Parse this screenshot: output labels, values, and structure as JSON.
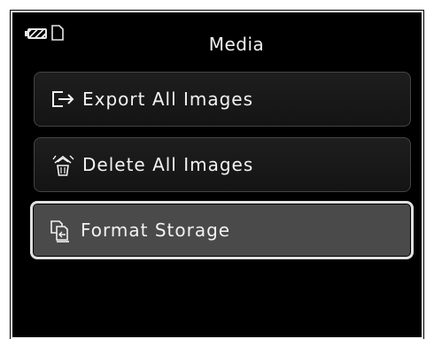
{
  "header": {
    "title": "Media",
    "battery_icon": "battery-icon",
    "storage_icon": "sd-card-icon"
  },
  "menu": {
    "items": [
      {
        "label": "Export All Images",
        "icon": "export-icon",
        "selected": false
      },
      {
        "label": "Delete All Images",
        "icon": "delete-icon",
        "selected": false
      },
      {
        "label": "Format Storage",
        "icon": "format-storage-icon",
        "selected": true
      }
    ]
  },
  "colors": {
    "background": "#000000",
    "button": "#1a1a1a",
    "button_selected": "#4a4a4a",
    "text": "#f2f2f2",
    "selection_border": "#e0e0e0"
  }
}
